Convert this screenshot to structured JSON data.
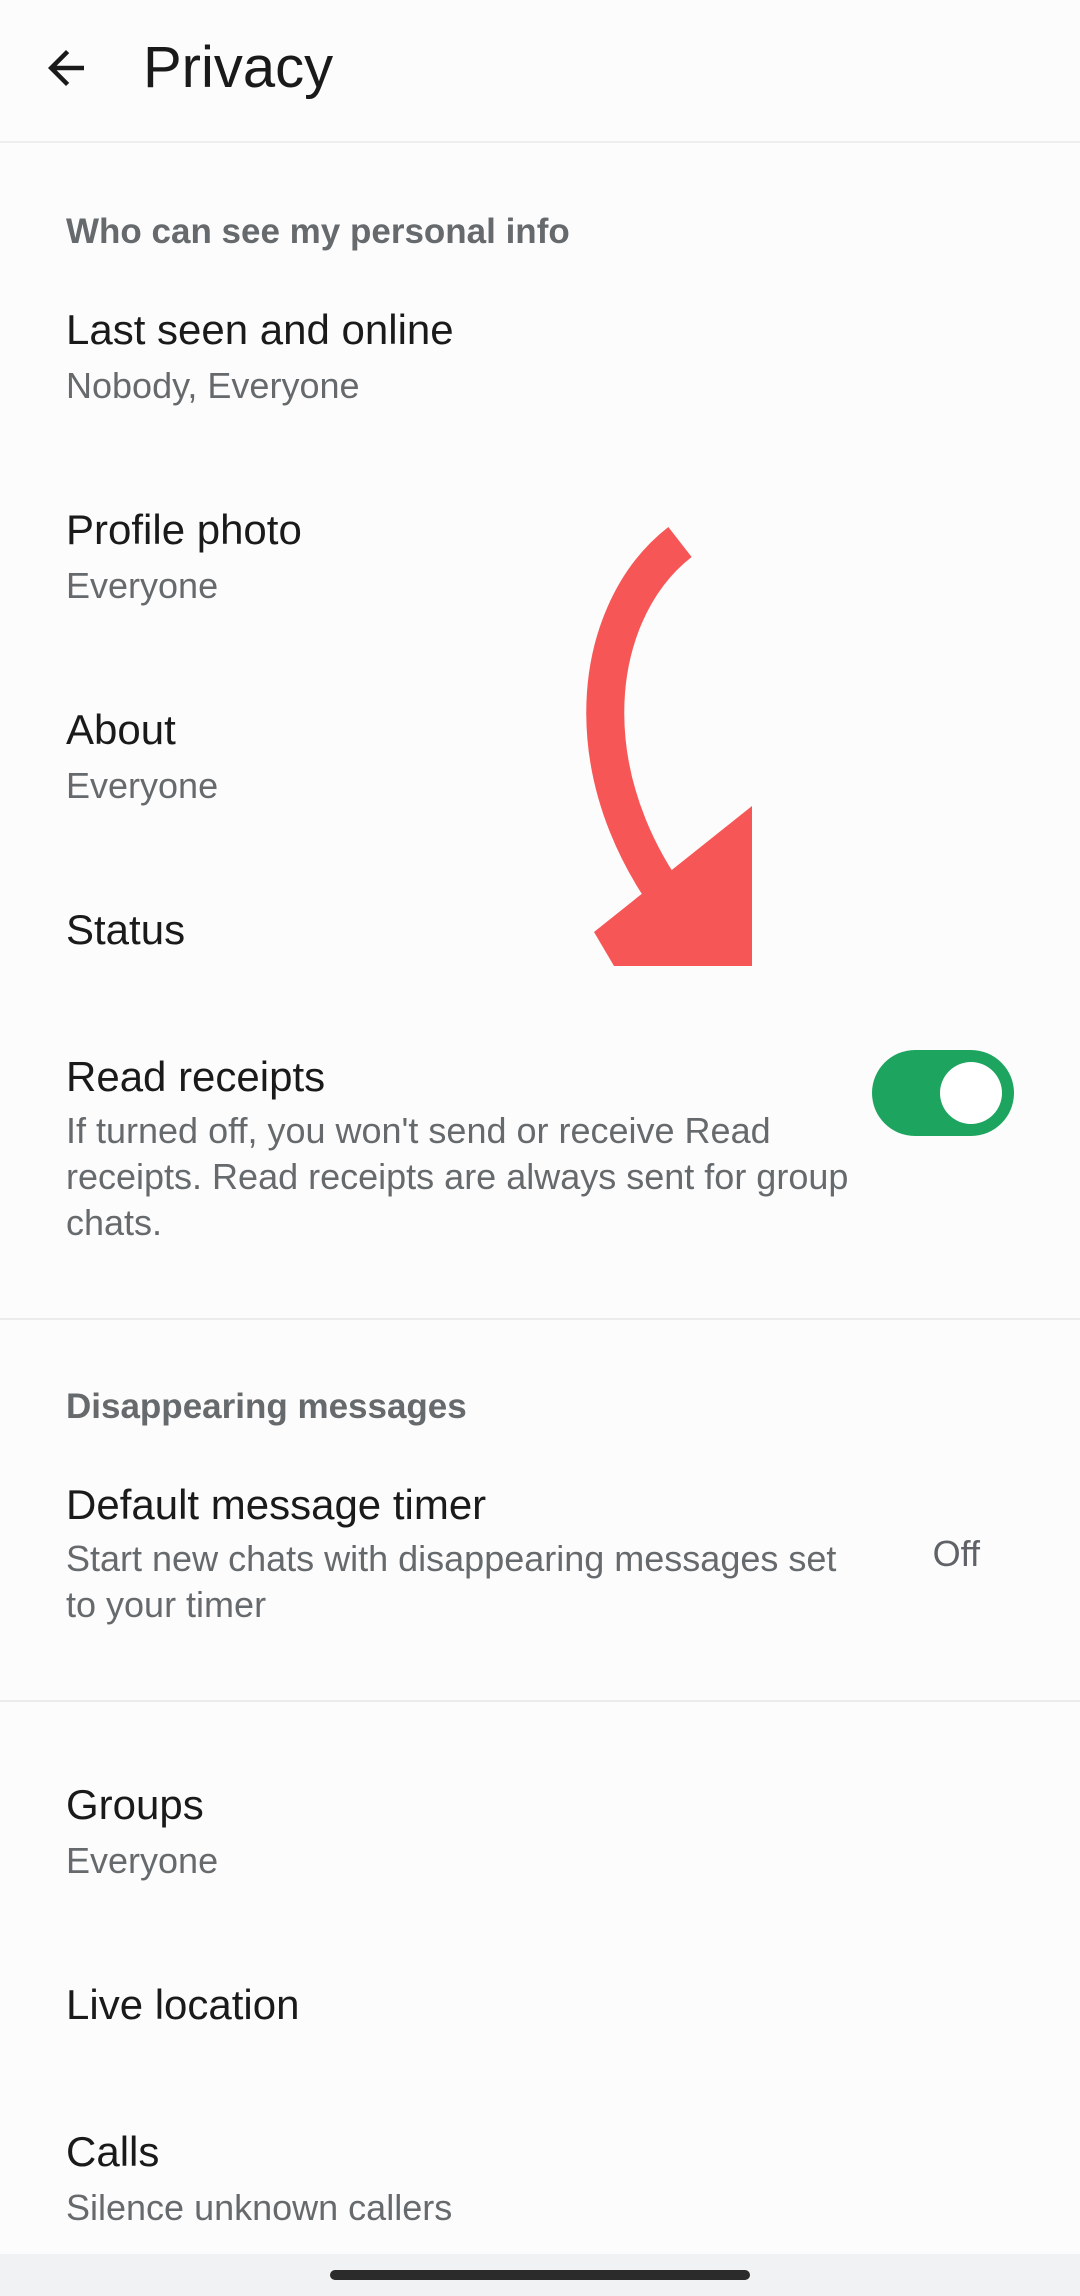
{
  "header": {
    "title": "Privacy",
    "back_icon": "arrow-left-icon"
  },
  "sections": {
    "personal_info": {
      "header": "Who can see my personal info",
      "items": [
        {
          "title": "Last seen and online",
          "subtitle": "Nobody, Everyone"
        },
        {
          "title": "Profile photo",
          "subtitle": "Everyone"
        },
        {
          "title": "About",
          "subtitle": "Everyone"
        },
        {
          "title": "Status",
          "subtitle": ""
        },
        {
          "title": "Read receipts",
          "description": "If turned off, you won't send or receive Read receipts. Read receipts are always sent for group chats.",
          "toggle_on": true
        }
      ]
    },
    "disappearing": {
      "header": "Disappearing messages",
      "items": [
        {
          "title": "Default message timer",
          "description": "Start new chats with disappearing messages set to your timer",
          "value": "Off"
        }
      ]
    },
    "other": {
      "items": [
        {
          "title": "Groups",
          "subtitle": "Everyone"
        },
        {
          "title": "Live location",
          "subtitle": ""
        },
        {
          "title": "Calls",
          "subtitle": "Silence unknown callers"
        }
      ]
    }
  },
  "colors": {
    "toggle_on": "#1da45f",
    "annotation_arrow": "#f75656",
    "secondary_text": "#666a6d"
  }
}
